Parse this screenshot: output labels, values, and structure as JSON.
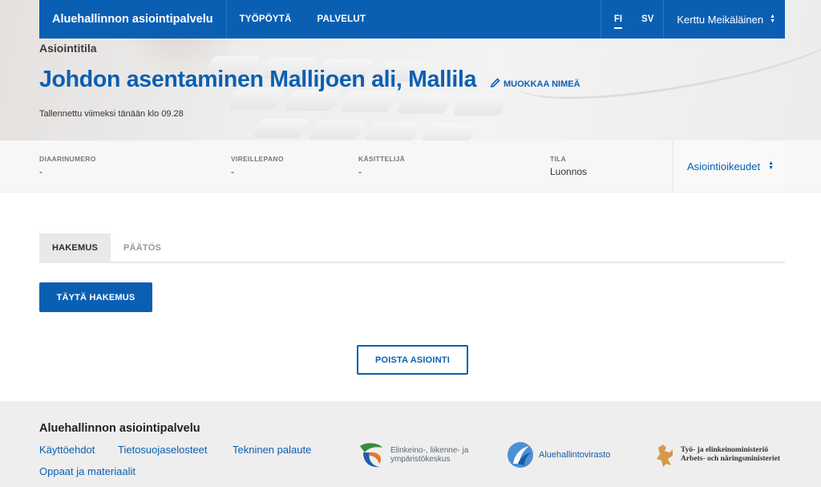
{
  "nav": {
    "brand": "Aluehallinnon asiointipalvelu",
    "links": [
      "TYÖPÖYTÄ",
      "PALVELUT"
    ],
    "languages": [
      "FI",
      "SV"
    ],
    "active_language": "FI",
    "user_name": "Kerttu Meikäläinen"
  },
  "header": {
    "section_label": "Asiointitila",
    "title": "Johdon asentaminen Mallijoen ali, Mallila",
    "edit_label": "MUOKKAA NIMEÄ",
    "saved_text": "Tallennettu viimeksi tänään klo 09.28"
  },
  "meta": {
    "fields": [
      {
        "label": "DIAARINUMERO",
        "value": "-"
      },
      {
        "label": "VIREILLEPANO",
        "value": "-"
      },
      {
        "label": "KÄSITTELIJÄ",
        "value": "-"
      },
      {
        "label": "TILA",
        "value": "Luonnos"
      }
    ],
    "rights_label": "Asiointioikeudet"
  },
  "tabs": [
    {
      "label": "HAKEMUS",
      "active": true
    },
    {
      "label": "PÄÄTÖS",
      "active": false
    }
  ],
  "actions": {
    "fill_application": "TÄYTÄ HAKEMUS",
    "delete_case": "POISTA ASIOINTI"
  },
  "footer": {
    "title": "Aluehallinnon asiointipalvelu",
    "links": [
      "Käyttöehdot",
      "Tietosuojaselosteet",
      "Tekninen palaute",
      "Oppaat ja materiaalit"
    ],
    "logos": [
      {
        "name": "ely-logo",
        "text_line1": "Elinkeino-, liikenne- ja",
        "text_line2": "ympäristökeskus"
      },
      {
        "name": "avi-logo",
        "text_line1": "Aluehallintovirasto"
      },
      {
        "name": "tem-logo",
        "text_line1": "Työ- ja elinkeinoministeriö",
        "text_line2": "Arbets- och näringsministeriet"
      }
    ]
  },
  "colors": {
    "primary": "#0b5fb3",
    "footer_bg": "#eeeeee",
    "meta_bg": "#f7f7f7"
  }
}
